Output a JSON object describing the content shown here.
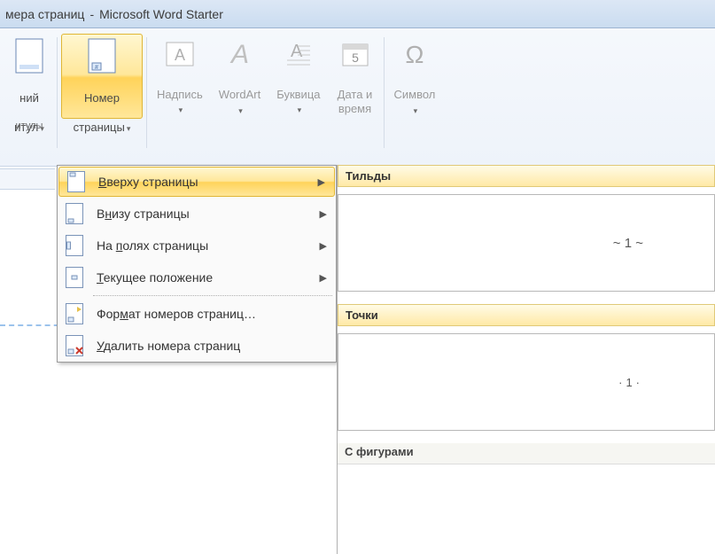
{
  "title_bar": {
    "doc": "мера страниц",
    "app": "Microsoft Word Starter"
  },
  "ribbon": {
    "partial_btn": {
      "line1": "ний",
      "line2": "итул"
    },
    "page_number": {
      "line1": "Номер",
      "line2": "страницы"
    },
    "textbox": {
      "label": "Надпись"
    },
    "wordart": {
      "label": "WordArt"
    },
    "dropcap": {
      "label": "Буквица"
    },
    "datetime": {
      "line1": "Дата и",
      "line2": "время"
    },
    "symbol": {
      "label": "Символ"
    },
    "group_label": "итулы"
  },
  "menu": {
    "top": "Вверху страницы",
    "top_mn": "В",
    "bottom": "Внизу страницы",
    "bottom_mn": "н",
    "margins": "На полях страницы",
    "margins_mn": "п",
    "current": "Текущее положение",
    "current_mn": "Т",
    "format": "Формат номеров страниц…",
    "format_mn": "м",
    "remove": "Удалить номера страниц",
    "remove_mn": "У"
  },
  "gallery": {
    "cat1": "Тильды",
    "sample1": "~ 1 ~",
    "cat2": "Точки",
    "sample2": "·1·",
    "cat3": "С фигурами"
  }
}
